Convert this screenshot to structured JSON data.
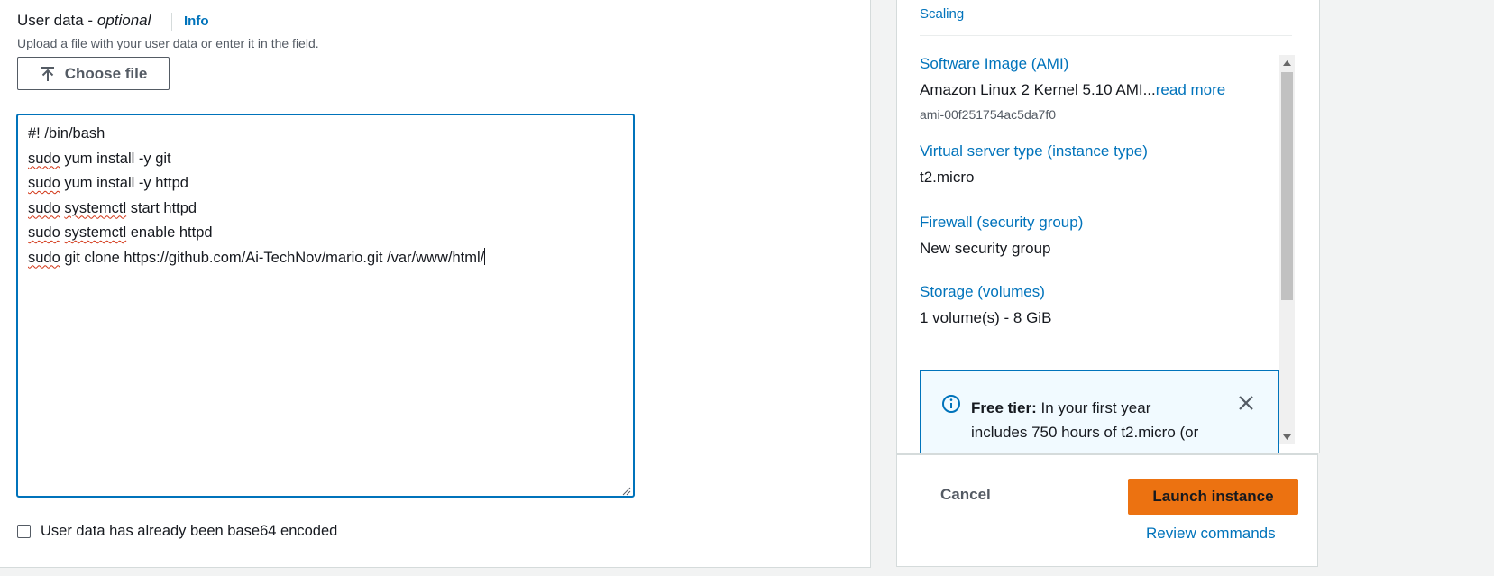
{
  "user_data": {
    "title": "User data -",
    "title_optional": "optional",
    "info_link": "Info",
    "description": "Upload a file with your user data or enter it in the field.",
    "choose_file_label": "Choose file",
    "script_lines": [
      [
        "#! /bin/bash"
      ],
      [
        {
          "sp": "sudo"
        },
        " yum install -y git"
      ],
      [
        {
          "sp": "sudo"
        },
        " yum install -y httpd"
      ],
      [
        {
          "sp": "sudo"
        },
        " ",
        {
          "sp": "systemctl"
        },
        " start httpd"
      ],
      [
        {
          "sp": "sudo"
        },
        " ",
        {
          "sp": "systemctl"
        },
        " enable httpd"
      ],
      [
        {
          "sp": "sudo"
        },
        " git clone https://github.com/Ai-TechNov/mario.git /var/www/html/",
        {
          "caret": true
        }
      ]
    ],
    "base64_checkbox_label": "User data has already been base64 encoded",
    "base64_checked": false
  },
  "summary": {
    "scaling_link": "Scaling",
    "ami_label": "Software Image (AMI)",
    "ami_value": "Amazon Linux 2 Kernel 5.10 AMI...",
    "ami_read_more": "read more",
    "ami_id": "ami-00f251754ac5da7f0",
    "instance_type_label": "Virtual server type (instance type)",
    "instance_type_value": "t2.micro",
    "firewall_label": "Firewall (security group)",
    "firewall_value": "New security group",
    "storage_label": "Storage (volumes)",
    "storage_value": "1 volume(s) - 8 GiB",
    "free_tier_title": "Free tier:",
    "free_tier_line1": "In your first year",
    "free_tier_line2": "includes 750 hours of t2.micro (or"
  },
  "actions": {
    "cancel_label": "Cancel",
    "launch_label": "Launch instance",
    "review_label": "Review commands"
  },
  "colors": {
    "link": "#0073bb",
    "primary_button": "#ec7211",
    "border_focus": "#0073bb",
    "spellcheck": "#d13212"
  },
  "icons": [
    "upload-icon",
    "info-circle-icon",
    "close-icon",
    "scroll-up-arrow-icon",
    "scroll-down-arrow-icon",
    "resize-grip-icon"
  ]
}
